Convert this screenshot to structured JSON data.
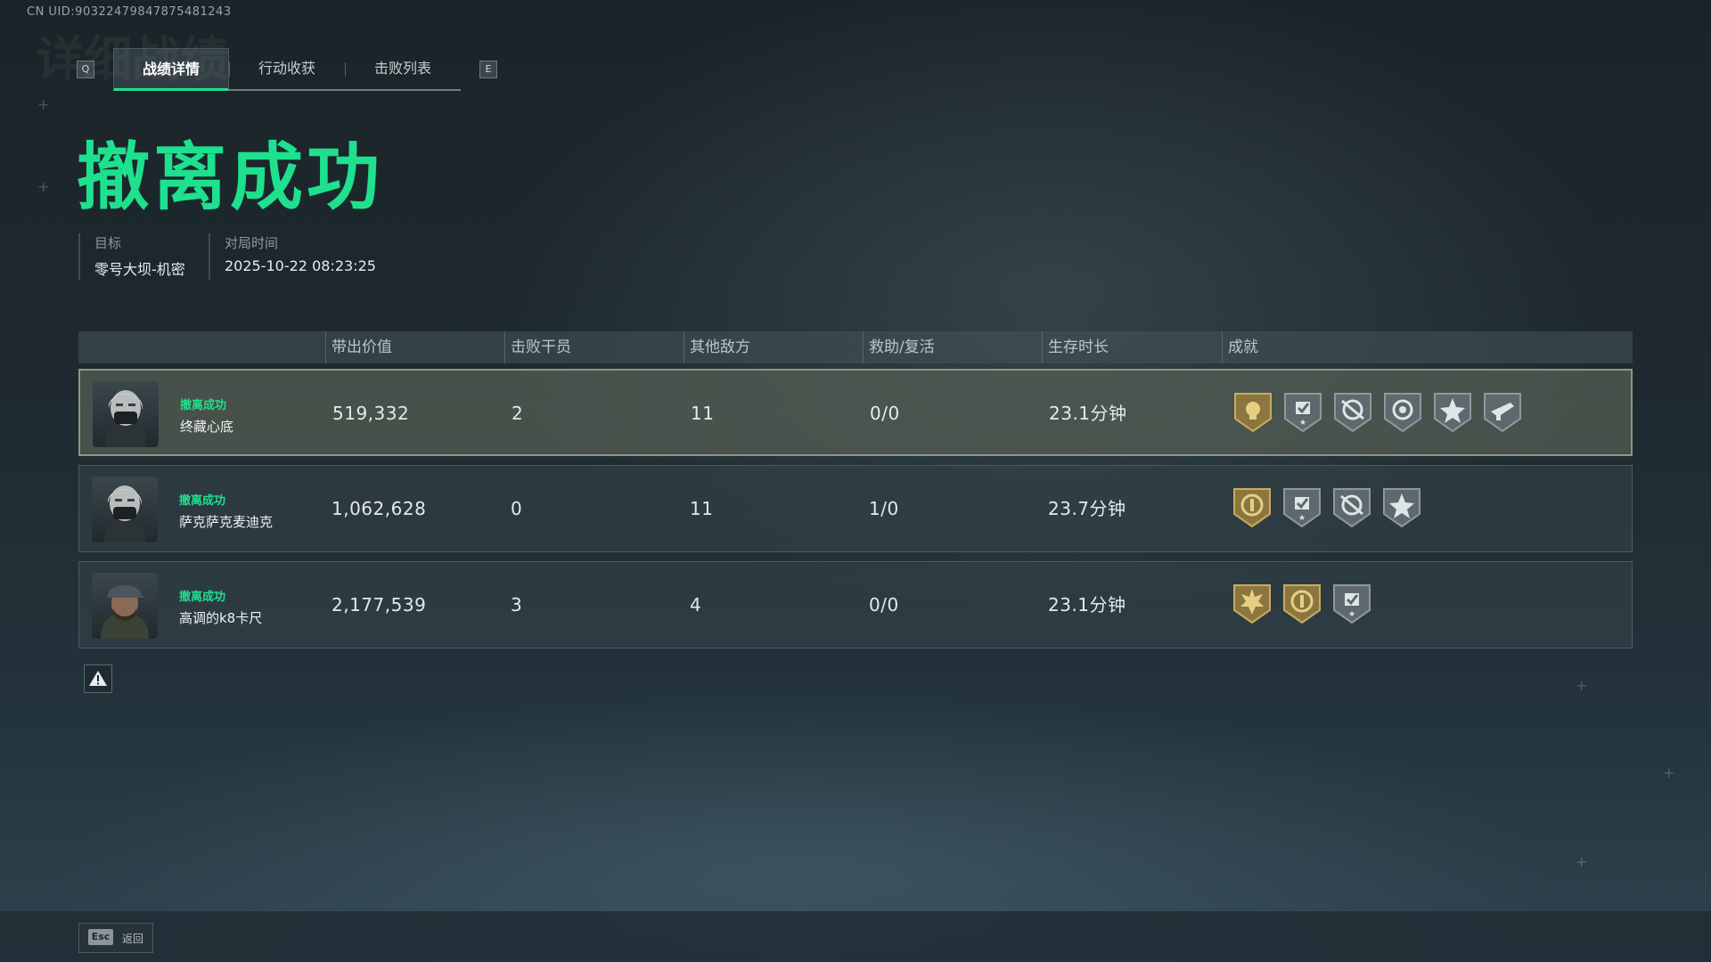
{
  "uid": "CN UID:9032247984787548​1243",
  "tabs_prev_key": "Q",
  "tabs_next_key": "E",
  "tabs": [
    {
      "label": "战绩详情",
      "active": true
    },
    {
      "label": "行动收获",
      "active": false
    },
    {
      "label": "击败列表",
      "active": false
    }
  ],
  "headline": "撤离成功",
  "info": {
    "target_label": "目标",
    "target_value": "零号大坝-机密",
    "time_label": "对局时间",
    "time_value": "2025-10-22 08:23:25"
  },
  "columns": [
    "带出价值",
    "击败干员",
    "其他敌方",
    "救助/复活",
    "生存时长",
    "成就"
  ],
  "players": [
    {
      "status": "撤离成功",
      "name": "终藏心底",
      "value": "519,332",
      "kills": "2",
      "other_enemies": "11",
      "assist_revive": "0/0",
      "survival": "23.1分钟",
      "badges": [
        "gold-skull-badge",
        "silver-check-badge",
        "silver-crosshair-badge",
        "silver-target-badge",
        "silver-star-badge",
        "silver-gun-badge"
      ]
    },
    {
      "status": "撤离成功",
      "name": "萨克萨克麦迪克",
      "value": "1,062,628",
      "kills": "0",
      "other_enemies": "11",
      "assist_revive": "1/0",
      "survival": "23.7分钟",
      "badges": [
        "gold-coin-badge",
        "silver-check-badge",
        "silver-crosshair-badge",
        "silver-star-badge"
      ]
    },
    {
      "status": "撤离成功",
      "name": "高调的k8卡尺",
      "value": "2,177,539",
      "kills": "3",
      "other_enemies": "4",
      "assist_revive": "0/0",
      "survival": "23.1分钟",
      "badges": [
        "gold-sun-badge",
        "gold-coin-badge",
        "silver-check-badge"
      ]
    }
  ],
  "footer": {
    "esc_key": "Esc",
    "back_label": "返回"
  },
  "colors": {
    "accent": "#1ee08e",
    "gold_badge": "#b79a4e",
    "silver_badge": "#7f8a8f"
  }
}
